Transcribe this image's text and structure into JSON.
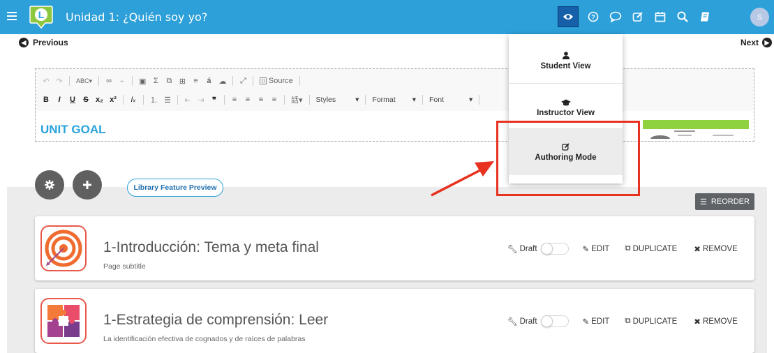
{
  "header": {
    "title": "Unidad 1: ¿Quién soy yo?",
    "logo_letter": "L",
    "avatar_initial": "S"
  },
  "nav": {
    "previous": "Previous",
    "next": "Next"
  },
  "editor": {
    "source_label": "Source",
    "styles_label": "Styles",
    "format_label": "Format",
    "font_label": "Font",
    "body_heading": "UNIT GOAL"
  },
  "view_menu": {
    "items": [
      {
        "label": "Student View",
        "icon": "user-icon"
      },
      {
        "label": "Instructor View",
        "icon": "graduation-cap-icon"
      },
      {
        "label": "Authoring Mode",
        "icon": "edit-icon",
        "selected": true
      }
    ]
  },
  "library_preview": "Library Feature Preview",
  "reorder_label": "REORDER",
  "pages": [
    {
      "title": "1-Introducción: Tema y meta final",
      "subtitle": "Page subtitle",
      "icon": "target-icon",
      "draft_label": "Draft",
      "draft_on": false,
      "edit_label": "EDIT",
      "duplicate_label": "DUPLICATE",
      "remove_label": "REMOVE"
    },
    {
      "title": "1-Estrategia de comprensión: Leer",
      "subtitle": "La identificación efectiva de cognados y de raíces de palabras",
      "icon": "puzzle-icon",
      "draft_label": "Draft",
      "draft_on": false,
      "edit_label": "EDIT",
      "duplicate_label": "DUPLICATE",
      "remove_label": "REMOVE"
    }
  ],
  "colors": {
    "topbar": "#2d9fd9",
    "accent_blue": "#29a3dc",
    "annotation_red": "#e8321f"
  }
}
